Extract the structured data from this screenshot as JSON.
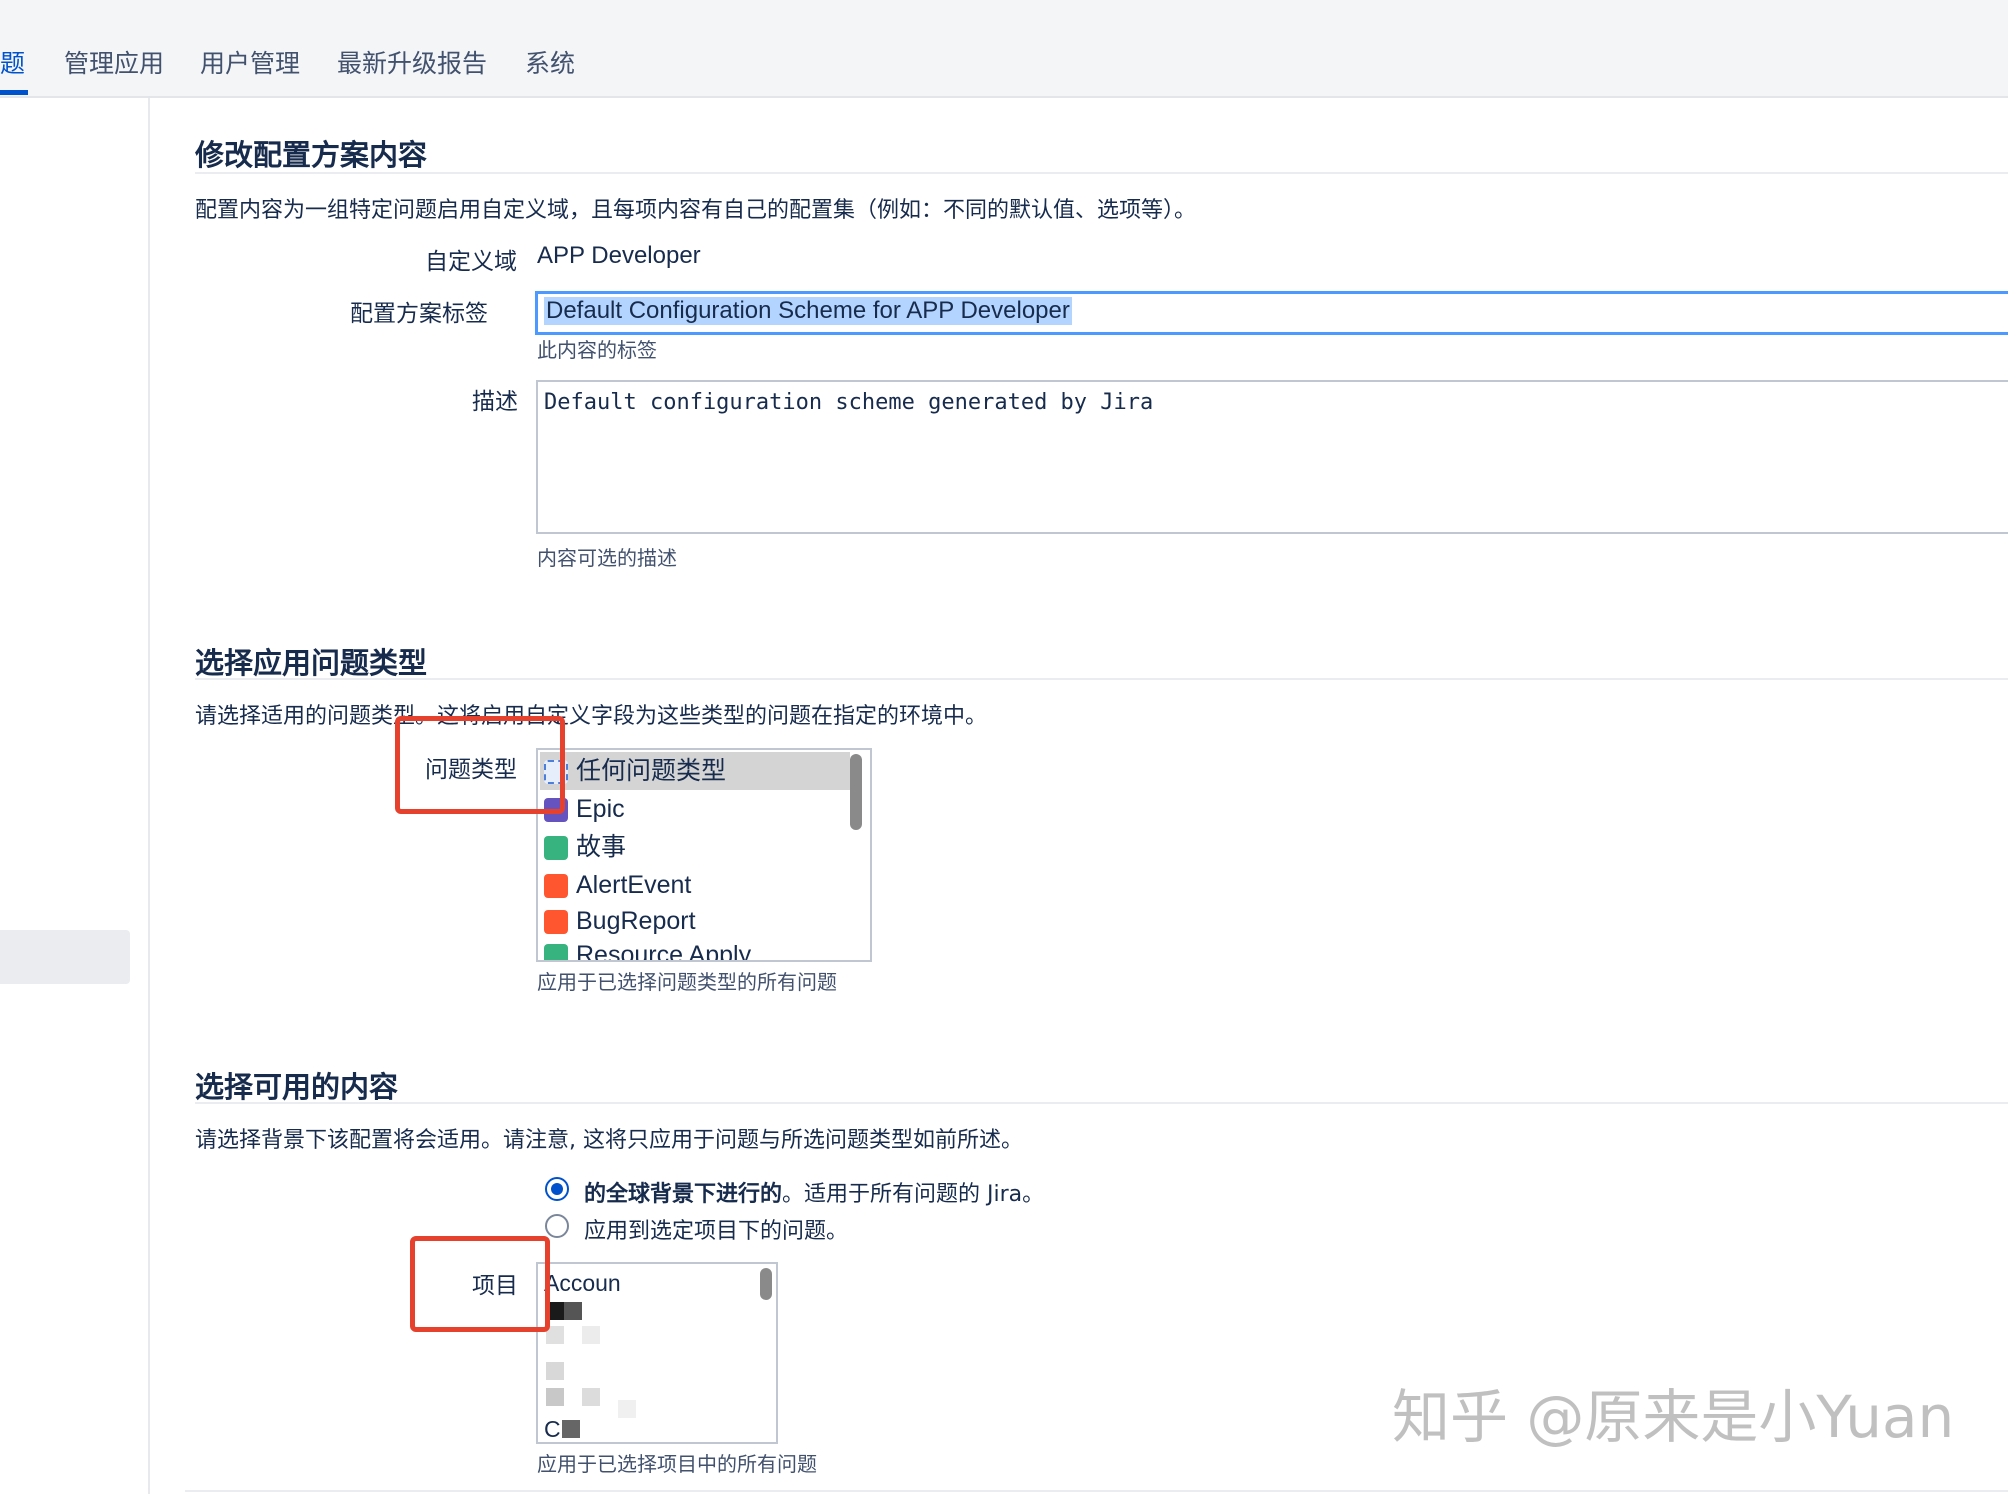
{
  "nav": {
    "tabs": [
      {
        "label": "题"
      },
      {
        "label": "管理应用"
      },
      {
        "label": "用户管理"
      },
      {
        "label": "最新升级报告"
      },
      {
        "label": "系统"
      }
    ]
  },
  "edit_section": {
    "title": "修改配置方案内容",
    "description": "配置内容为一组特定问题启用自定义域，且每项内容有自己的配置集（例如：不同的默认值、选项等）。",
    "custom_field_label": "自定义域",
    "custom_field_value": "APP Developer",
    "scheme_label_label": "配置方案标签",
    "scheme_label_value": "Default Configuration Scheme for APP Developer",
    "scheme_label_hint": "此内容的标签",
    "desc_label": "描述",
    "desc_value": "Default configuration scheme generated by Jira",
    "desc_hint": "内容可选的描述"
  },
  "issue_types_section": {
    "title": "选择应用问题类型",
    "description": "请选择适用的问题类型。这将启用自定义字段为这些类型的问题在指定的环境中。",
    "label": "问题类型",
    "options": [
      {
        "label": "任何问题类型",
        "icon": "any-issue-type-icon",
        "color": "#a5b8d4",
        "selected": true
      },
      {
        "label": "Epic",
        "icon": "epic-icon",
        "color": "#6554c0"
      },
      {
        "label": "故事",
        "icon": "story-icon",
        "color": "#36b37e"
      },
      {
        "label": "AlertEvent",
        "icon": "alert-event-icon",
        "color": "#ff5630"
      },
      {
        "label": "BugReport",
        "icon": "bug-report-icon",
        "color": "#ff5630"
      },
      {
        "label": "Resource Apply",
        "icon": "resource-apply-icon",
        "color": "#36b37e"
      }
    ],
    "hint": "应用于已选择问题类型的所有问题"
  },
  "context_section": {
    "title": "选择可用的内容",
    "description": "请选择背景下该配置将会适用。请注意, 这将只应用于问题与所选问题类型如前所述。",
    "radio_global_bold": "的全球背景下进行的",
    "radio_global_rest": "。适用于所有问题的 Jira。",
    "radio_selected": "应用到选定项目下的问题。",
    "project_label": "项目",
    "project_first_visible": "Accoun",
    "project_last_visible": "Cl",
    "project_hint": "应用于已选择项目中的所有问题"
  },
  "watermark": "知乎 @原来是小Yuan",
  "colors": {
    "accent": "#0052cc",
    "highlight": "#e5412d"
  }
}
